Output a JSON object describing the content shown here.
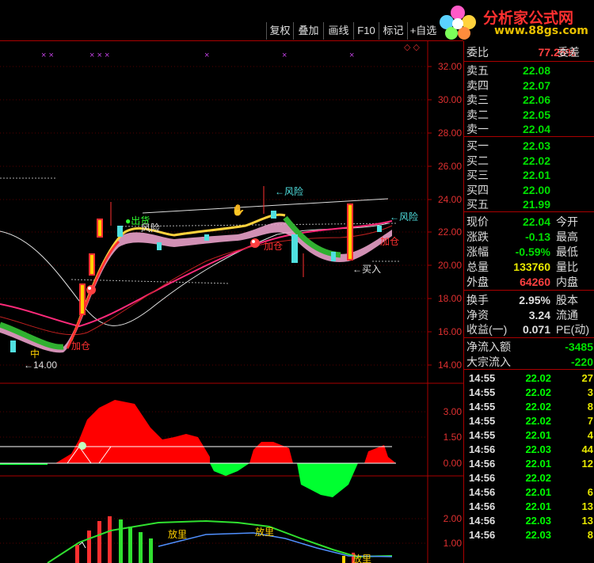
{
  "toolbar": {
    "buttons": [
      "复权",
      "叠加",
      "画线",
      "F10",
      "标记",
      "+自选"
    ]
  },
  "logo": {
    "title": "分析家公式网",
    "url": "www.88gs.com"
  },
  "main_chart": {
    "y_ticks": [
      "32.00",
      "30.00",
      "28.00",
      "26.00",
      "24.00",
      "22.00",
      "20.00",
      "18.00",
      "16.00",
      "14.00"
    ],
    "annotations": {
      "risk1": "←风险",
      "risk2": "←风险",
      "chuhuo": "●出货",
      "fengxian_small": "风险",
      "jiacang1": "加仓",
      "jiacang2": "加仓",
      "jiacang3": "加仓",
      "mairu": "←买入",
      "low": "←14.00",
      "zhong": "中"
    }
  },
  "macd_chart": {
    "y_ticks": [
      "3.00",
      "1.50",
      "0.00"
    ]
  },
  "vol_chart": {
    "y_ticks": [
      "2.00",
      "1.00"
    ],
    "labels": [
      "放里",
      "放里",
      "放里"
    ]
  },
  "quote": {
    "weibi_label": "委比",
    "weibi_value": "77.25%",
    "weicha_label": "委差",
    "sell": [
      {
        "label": "卖五",
        "price": "22.08"
      },
      {
        "label": "卖四",
        "price": "22.07"
      },
      {
        "label": "卖三",
        "price": "22.06"
      },
      {
        "label": "卖二",
        "price": "22.05"
      },
      {
        "label": "卖一",
        "price": "22.04"
      }
    ],
    "buy": [
      {
        "label": "买一",
        "price": "22.03"
      },
      {
        "label": "买二",
        "price": "22.02"
      },
      {
        "label": "买三",
        "price": "22.01"
      },
      {
        "label": "买四",
        "price": "22.00"
      },
      {
        "label": "买五",
        "price": "21.99"
      }
    ],
    "stats": [
      {
        "l1": "现价",
        "v1": "22.04",
        "c1": "grn",
        "l2": "今开"
      },
      {
        "l1": "涨跌",
        "v1": "-0.13",
        "c1": "grn",
        "l2": "最高"
      },
      {
        "l1": "涨幅",
        "v1": "-0.59%",
        "c1": "grn",
        "l2": "最低"
      },
      {
        "l1": "总量",
        "v1": "133760",
        "c1": "yel",
        "l2": "量比"
      },
      {
        "l1": "外盘",
        "v1": "64260",
        "c1": "red",
        "l2": "内盘"
      }
    ],
    "stats2": [
      {
        "l1": "换手",
        "v1": "2.95%",
        "c1": "wht",
        "l2": "股本"
      },
      {
        "l1": "净资",
        "v1": "3.24",
        "c1": "wht",
        "l2": "流通"
      },
      {
        "l1": "收益(一)",
        "v1": "0.071",
        "c1": "wht",
        "l2": "PE(动)"
      }
    ],
    "flow": [
      {
        "label": "净流入额",
        "value": "-3485"
      },
      {
        "label": "大宗流入",
        "value": "-220"
      }
    ],
    "ticks": [
      {
        "t": "14:55",
        "p": "22.02",
        "q": "27"
      },
      {
        "t": "14:55",
        "p": "22.02",
        "q": "3"
      },
      {
        "t": "14:55",
        "p": "22.02",
        "q": "8"
      },
      {
        "t": "14:55",
        "p": "22.02",
        "q": "7"
      },
      {
        "t": "14:55",
        "p": "22.01",
        "q": "4"
      },
      {
        "t": "14:56",
        "p": "22.03",
        "q": "44"
      },
      {
        "t": "14:56",
        "p": "22.01",
        "q": "12"
      },
      {
        "t": "14:56",
        "p": "22.02",
        "q": ""
      },
      {
        "t": "14:56",
        "p": "22.01",
        "q": "6"
      },
      {
        "t": "14:56",
        "p": "22.01",
        "q": "13"
      },
      {
        "t": "14:56",
        "p": "22.03",
        "q": "13"
      },
      {
        "t": "14:56",
        "p": "22.03",
        "q": "8"
      }
    ]
  }
}
